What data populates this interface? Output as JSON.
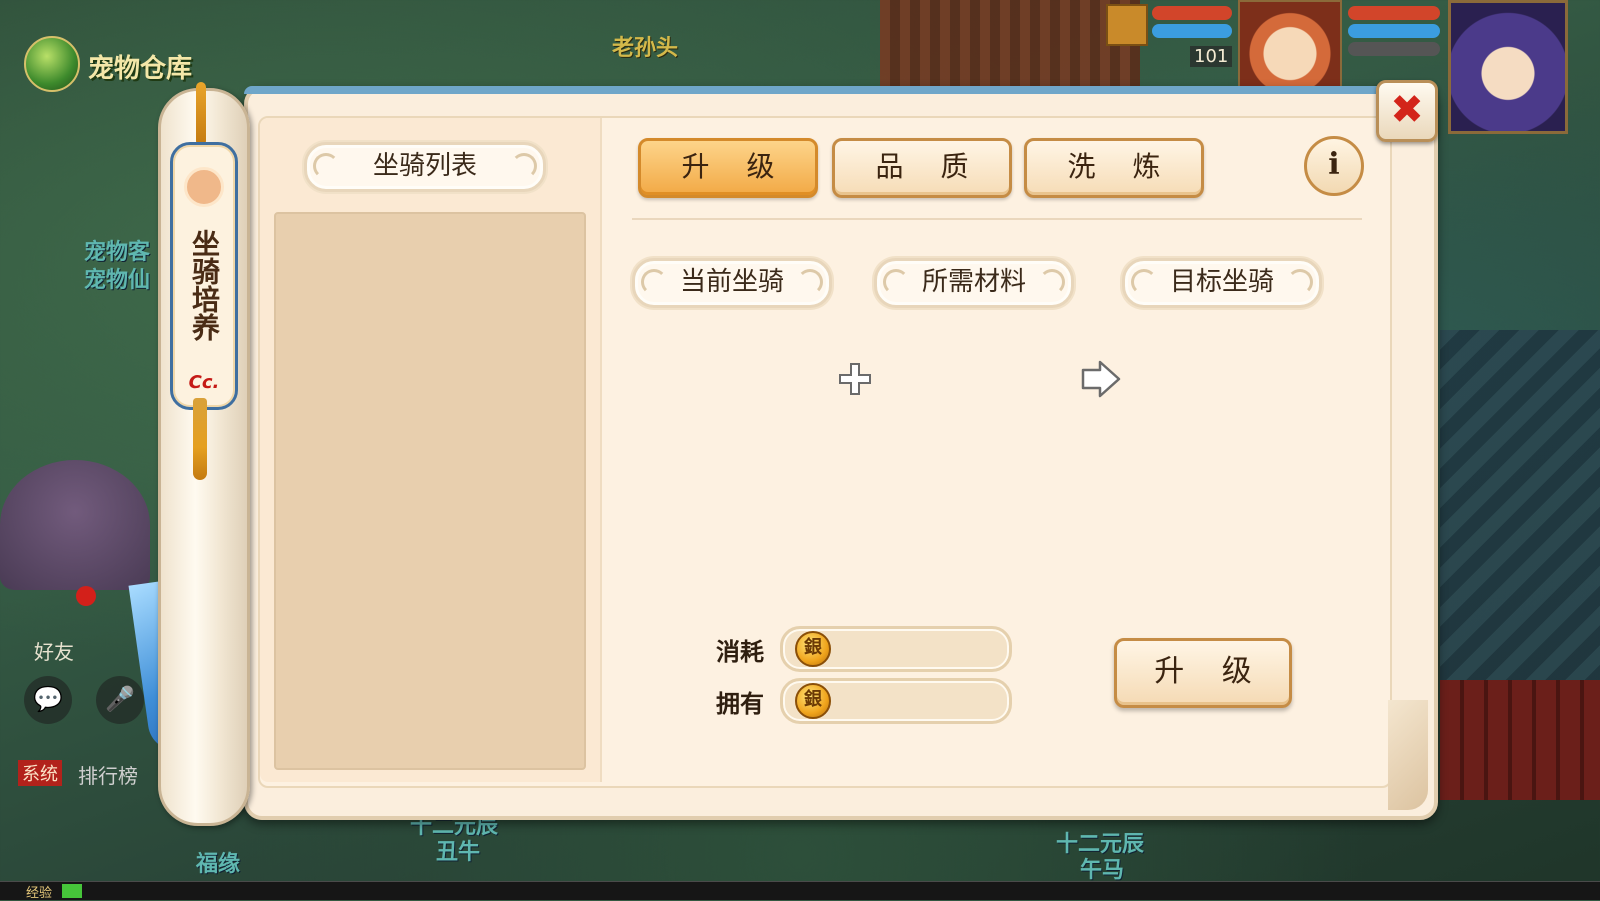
{
  "background": {
    "pet_storage_label": "宠物仓库",
    "npc_name_top": "老孙头",
    "npc_label_left_1": "宠物客",
    "npc_label_left_2": "宠物仙",
    "npc_label_bottom_1": "十二元辰",
    "npc_label_bottom_2": "丑牛",
    "npc_label_bottom_3": "十二元辰",
    "npc_label_bottom_4": "午马",
    "npc_label_bottom_5": "福缘"
  },
  "hud": {
    "level": "101"
  },
  "chat": {
    "friend_label": "好友",
    "system_tag": "系统",
    "ranking_label": "排行榜"
  },
  "exp_bar": {
    "label": "经验",
    "progress_fraction": 0.013
  },
  "side_tab": {
    "title": "坐骑培养",
    "logo": "Cc."
  },
  "left_panel": {
    "title": "坐骑列表"
  },
  "tabs": [
    {
      "label": "升 级",
      "active": true
    },
    {
      "label": "品 质",
      "active": false
    },
    {
      "label": "洗 炼",
      "active": false
    }
  ],
  "info_label": "i",
  "sections": {
    "current_mount": "当前坐骑",
    "required_material": "所需材料",
    "target_mount": "目标坐骑"
  },
  "cost": {
    "consume_label": "消耗",
    "consume_value": "",
    "own_label": "拥有",
    "own_value": ""
  },
  "upgrade_button": "升 级",
  "close_symbol": "✖",
  "colors": {
    "active_tab": "#f2a945",
    "close_red": "#d3241a",
    "panel_bg": "#fbeedd"
  }
}
